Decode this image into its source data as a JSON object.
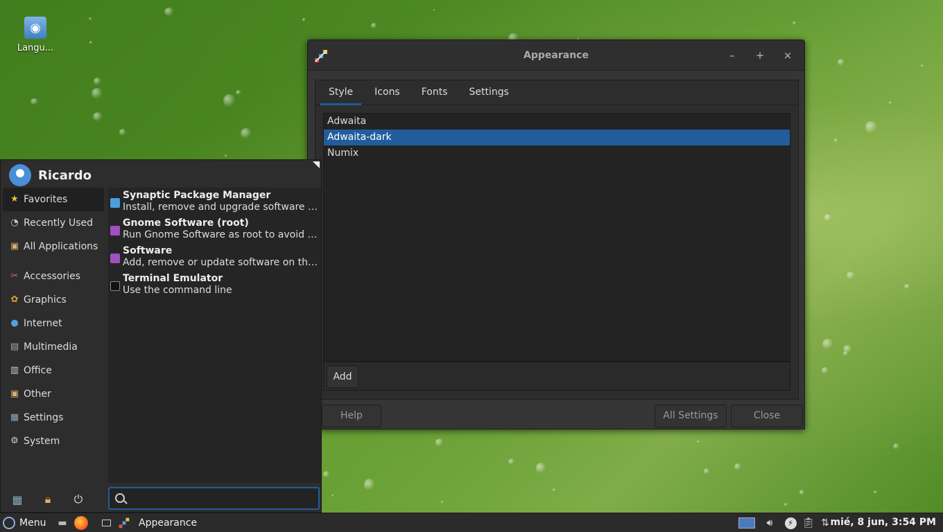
{
  "desktop": {
    "icons": [
      {
        "label": "Langu...",
        "icon": "language-icon"
      }
    ]
  },
  "appearance_window": {
    "title": "Appearance",
    "controls": {
      "minimize": "–",
      "maximize": "+",
      "close": "×"
    },
    "tabs": [
      {
        "label": "Style",
        "active": true
      },
      {
        "label": "Icons",
        "active": false
      },
      {
        "label": "Fonts",
        "active": false
      },
      {
        "label": "Settings",
        "active": false
      }
    ],
    "styles": [
      {
        "label": "Adwaita",
        "selected": false
      },
      {
        "label": "Adwaita-dark",
        "selected": true
      },
      {
        "label": "Numix",
        "selected": false
      }
    ],
    "add_label": "Add",
    "help_label": "Help",
    "all_settings_label": "All Settings",
    "close_label": "Close"
  },
  "menu": {
    "username": "Ricardo",
    "categories": [
      {
        "label": "Favorites",
        "icon": "star-icon",
        "selected": true
      },
      {
        "label": "Recently Used",
        "icon": "history-icon",
        "selected": false
      },
      {
        "label": "All Applications",
        "icon": "folder-icon",
        "selected": false
      },
      {
        "label": "Accessories",
        "icon": "accessories-icon",
        "selected": false
      },
      {
        "label": "Graphics",
        "icon": "palette-icon",
        "selected": false
      },
      {
        "label": "Internet",
        "icon": "globe-icon",
        "selected": false
      },
      {
        "label": "Multimedia",
        "icon": "multimedia-icon",
        "selected": false
      },
      {
        "label": "Office",
        "icon": "office-icon",
        "selected": false
      },
      {
        "label": "Other",
        "icon": "folder-icon",
        "selected": false
      },
      {
        "label": "Settings",
        "icon": "settings-icon",
        "selected": false
      },
      {
        "label": "System",
        "icon": "gear-icon",
        "selected": false
      }
    ],
    "apps": [
      {
        "name": "Synaptic Package Manager",
        "desc": "Install, remove and upgrade software packages",
        "icon": "synaptic-icon"
      },
      {
        "name": "Gnome Software (root)",
        "desc": "Run Gnome Software as root to avoid problems",
        "icon": "software-icon"
      },
      {
        "name": "Software",
        "desc": "Add, remove or update software on this computer",
        "icon": "software-icon"
      },
      {
        "name": "Terminal Emulator",
        "desc": "Use the command line",
        "icon": "terminal-icon"
      }
    ],
    "search_placeholder": ""
  },
  "panel": {
    "menu_label": "Menu",
    "task_label": "Appearance",
    "clock": "mié,  8 jun,  3:54 PM"
  },
  "colors": {
    "accent": "#215d9c",
    "window_bg": "#353535",
    "menu_bg": "#2d2d2d"
  }
}
